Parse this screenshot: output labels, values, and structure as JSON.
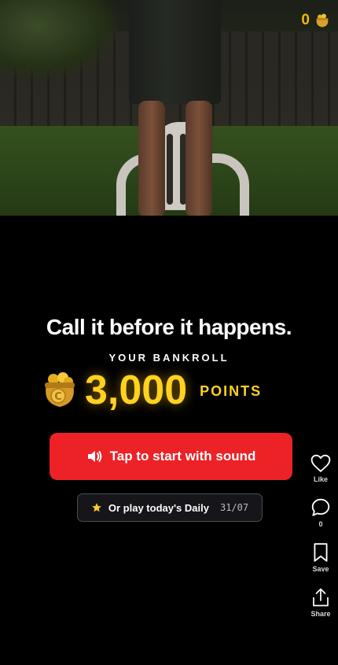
{
  "header": {
    "coin_count": "0"
  },
  "hero": {
    "headline": "Call it before it happens.",
    "bankroll_label": "YOUR BANKROLL",
    "bankroll_amount": "3,000",
    "bankroll_unit": "POINTS"
  },
  "actions": {
    "sound_button_label": "Tap to start with sound",
    "daily_button_label": "Or play today's Daily",
    "daily_date": "31/07"
  },
  "sidebar": {
    "like_label": "Like",
    "comment_count": "0",
    "save_label": "Save",
    "share_label": "Share"
  },
  "colors": {
    "accent_gold": "#ffd21f",
    "button_red": "#ec2226"
  }
}
